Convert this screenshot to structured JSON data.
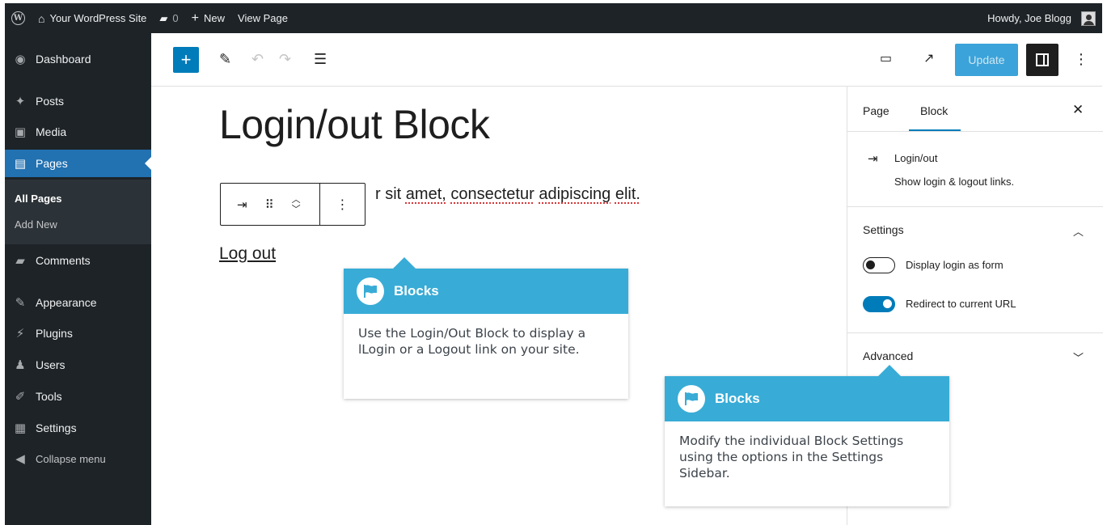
{
  "admin_bar": {
    "site_name": "Your WordPress Site",
    "comments_count": "0",
    "new_label": "New",
    "view_page_label": "View Page",
    "greeting": "Howdy, Joe Blogg"
  },
  "sidebar": {
    "dashboard": "Dashboard",
    "posts": "Posts",
    "media": "Media",
    "pages": "Pages",
    "all_pages": "All Pages",
    "add_new": "Add New",
    "comments": "Comments",
    "appearance": "Appearance",
    "plugins": "Plugins",
    "users": "Users",
    "tools": "Tools",
    "settings": "Settings",
    "collapse": "Collapse menu"
  },
  "toolbar": {
    "update_label": "Update"
  },
  "editor": {
    "title": "Login/out Block",
    "paragraph_visible": "r sit ",
    "paragraph_words": [
      "amet,",
      "consectetur",
      "adipiscing",
      "elit."
    ],
    "logout_link": "Log out"
  },
  "panel": {
    "tab_page": "Page",
    "tab_block": "Block",
    "block_name": "Login/out",
    "block_description": "Show login & logout links.",
    "settings_heading": "Settings",
    "toggle_form_label": "Display login as form",
    "toggle_form_on": false,
    "toggle_redirect_label": "Redirect to current URL",
    "toggle_redirect_on": true,
    "advanced_heading": "Advanced"
  },
  "tooltips": [
    {
      "title": "Blocks",
      "body": "Use the Login/Out Block to display a lLogin or a Logout link on your site."
    },
    {
      "title": "Blocks",
      "body": "Modify the individual Block Settings using the options in the Settings Sidebar."
    }
  ],
  "colors": {
    "admin_dark": "#1d2327",
    "accent": "#007cba",
    "tooltip_blue": "#38acd6"
  }
}
